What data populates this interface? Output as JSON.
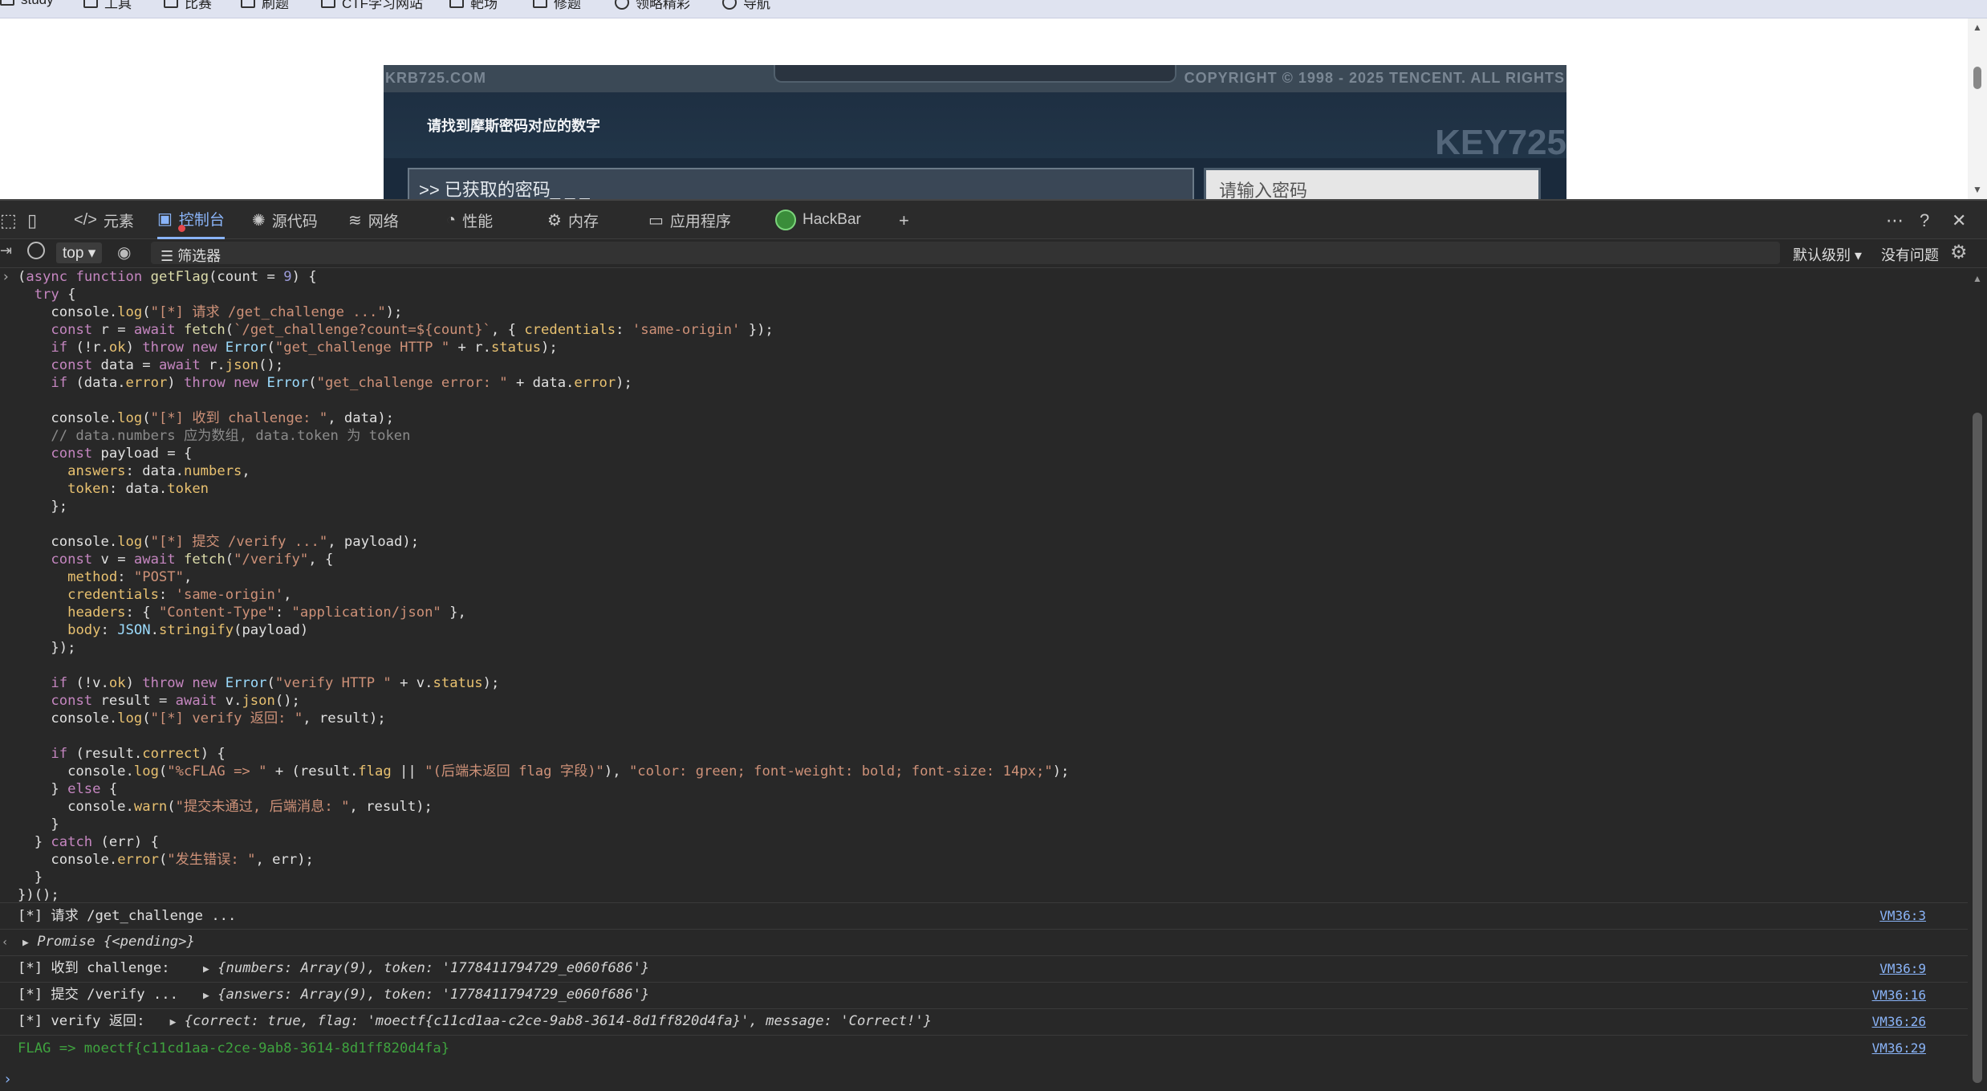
{
  "bookmarks": [
    {
      "label": "study",
      "icon": "folder-icon"
    },
    {
      "label": "工具",
      "icon": "folder-icon"
    },
    {
      "label": "比赛",
      "icon": "folder-icon"
    },
    {
      "label": "刷题",
      "icon": "folder-icon"
    },
    {
      "label": "CTF学习网站",
      "icon": "folder-icon"
    },
    {
      "label": "靶场",
      "icon": "folder-icon"
    },
    {
      "label": "修题",
      "icon": "folder-icon"
    },
    {
      "label": "领略精彩",
      "icon": "globe-icon"
    },
    {
      "label": "导航",
      "icon": "globe-icon"
    }
  ],
  "game": {
    "site": "KRB725.COM",
    "copyright": "COPYRIGHT © 1998 - 2025 TENCENT. ALL RIGHTS",
    "prompt": "请找到摩斯密码对应的数字",
    "key": "KEY725",
    "password_display": ">> 已获取的密码_ _ _",
    "password_placeholder": "请输入密码_ _ _"
  },
  "devtools": {
    "tabs": [
      {
        "label": "元素",
        "icon": "code-icon"
      },
      {
        "label": "控制台",
        "icon": "console-icon",
        "active": true
      },
      {
        "label": "源代码",
        "icon": "bug-icon"
      },
      {
        "label": "网络",
        "icon": "wifi-icon"
      },
      {
        "label": "性能",
        "icon": "performance-icon"
      },
      {
        "label": "内存",
        "icon": "memory-icon"
      },
      {
        "label": "应用程序",
        "icon": "application-icon"
      },
      {
        "label": "HackBar",
        "icon": "hackbar-icon"
      }
    ],
    "add_tab": "+",
    "more": "⋯",
    "help": "?",
    "close": "✕"
  },
  "console_toolbar": {
    "context": "top",
    "filter_placeholder": "筛选器",
    "levels": "默认级别",
    "issues": "没有问题"
  },
  "code_lines": [
    "(async function getFlag(count = 9) {",
    "  try {",
    "    console.log(\"[*] 请求 /get_challenge ...\");",
    "    const r = await fetch(`/get_challenge?count=${count}`, { credentials: 'same-origin' });",
    "    if (!r.ok) throw new Error(\"get_challenge HTTP \" + r.status);",
    "    const data = await r.json();",
    "    if (data.error) throw new Error(\"get_challenge error: \" + data.error);",
    "",
    "    console.log(\"[*] 收到 challenge: \", data);",
    "    // data.numbers 应为数组, data.token 为 token",
    "    const payload = {",
    "      answers: data.numbers,",
    "      token: data.token",
    "    };",
    "",
    "    console.log(\"[*] 提交 /verify ...\", payload);",
    "    const v = await fetch(\"/verify\", {",
    "      method: \"POST\",",
    "      credentials: 'same-origin',",
    "      headers: { \"Content-Type\": \"application/json\" },",
    "      body: JSON.stringify(payload)",
    "    });",
    "",
    "    if (!v.ok) throw new Error(\"verify HTTP \" + v.status);",
    "    const result = await v.json();",
    "    console.log(\"[*] verify 返回: \", result);",
    "",
    "    if (result.correct) {",
    "      console.log(\"%cFLAG => \" + (result.flag || \"(后端未返回 flag 字段)\"), \"color: green; font-weight: bold; font-size: 14px;\");",
    "    } else {",
    "      console.warn(\"提交未通过, 后端消息: \", result);",
    "    }",
    "  } catch (err) {",
    "    console.error(\"发生错误: \", err);",
    "  }",
    "})();"
  ],
  "logs": [
    {
      "text": "[*] 请求 /get_challenge ...",
      "source": "VM36:3"
    },
    {
      "text": "Promise {<pending>}",
      "source": ""
    },
    {
      "label": "[*] 收到 challenge: ",
      "object": "{numbers: Array(9), token: '1778411794729_e060f686'}",
      "source": "VM36:9"
    },
    {
      "label": "[*] 提交 /verify ... ",
      "object": "{answers: Array(9), token: '1778411794729_e060f686'}",
      "source": "VM36:16"
    },
    {
      "label": "[*] verify 返回: ",
      "object": "{correct: true, flag: 'moectf{c11cd1aa-c2ce-9ab8-3614-8d1ff820d4fa}', message: 'Correct!'}",
      "source": "VM36:26"
    },
    {
      "text": "FLAG => moectf{c11cd1aa-c2ce-9ab8-3614-8d1ff820d4fa}",
      "source": "VM36:29"
    }
  ],
  "colors": {
    "accent": "#8ab4f8",
    "flag_green": "#3fa33f",
    "console_bg": "#282828"
  }
}
